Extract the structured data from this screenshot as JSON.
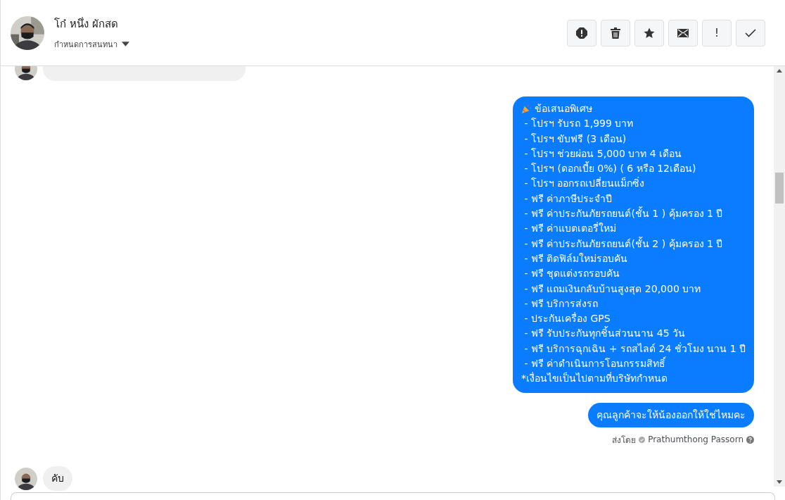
{
  "header": {
    "name": "โก๋ หนึ่ง ผักสด",
    "subtitle": "กำหนดการสนทนา",
    "actions": [
      {
        "kind": "alert"
      },
      {
        "kind": "trash"
      },
      {
        "kind": "star"
      },
      {
        "kind": "mail"
      },
      {
        "kind": "exclaim",
        "label": "!"
      },
      {
        "kind": "check"
      }
    ]
  },
  "messages": [
    {
      "kind": "incoming"
    },
    {
      "kind": "outgoing",
      "title": "ข้อเสนอพิเศษ",
      "lines": [
        " - โปรฯ รับรถ 1,999 บาท",
        " - โปรฯ ขับฟรี (3 เดือน)",
        " - โปรฯ ช่วยผ่อน 5,000 บาท 4 เดือน",
        " - โปรฯ (ดอกเบี้ย 0%) ( 6 หรือ 12เดือน)",
        " - โปรฯ ออกรถเปลี่ยนแม็กซิ่ง",
        " - ฟรี ค่าภาษีประจำปี",
        " - ฟรี ค่าประกันภัยรถยนต์(ชั้น 1 ) คุ้มครอง 1 ปี",
        " - ฟรี ค่าแบตเตอรี่ใหม่",
        " - ฟรี ค่าประกันภัยรถยนต์(ชั้น 2 ) คุ้มครอง 1 ปี",
        " - ฟรี ติดฟิล์มใหม่รอบคัน",
        " - ฟรี ชุดแต่งรถรอบคัน",
        " - ฟรี แถมเงินกลับบ้านสูงสุด 20,000 บาท",
        " - ฟรี บริการส่งรถ",
        " - ประกันเครื่อง GPS",
        " - ฟรี รับประกันทุกชิ้นส่วนนาน 45 วัน",
        " - ฟรี บริการฉุกเฉิน + รถสไลด์ 24 ชั่วโมง นาน 1 ปี",
        " - ฟรี ค่าดำเนินการโอนกรรมสิทธิ์",
        "*เงื่อนไขเป็นไปตามที่บริษัทกำหนด"
      ]
    },
    {
      "kind": "outgoing",
      "text": "คุณลูกค้าจะให้น้องออกให้ใช่ไหมคะ",
      "sent_by": "ส่งโดย",
      "sender": "Prathumthong Passorn"
    },
    {
      "kind": "incoming",
      "text": "คับ"
    }
  ]
}
